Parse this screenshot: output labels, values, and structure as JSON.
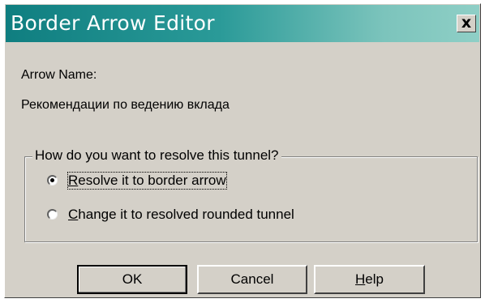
{
  "window": {
    "title": "Border Arrow Editor",
    "close_glyph": "x"
  },
  "arrow": {
    "name_label": "Arrow Name:",
    "name_value": "Рекомендации по ведению вклада"
  },
  "group": {
    "legend": "How do you want to resolve this tunnel?",
    "options": [
      {
        "mnemonic": "R",
        "rest": "esolve it to border arrow",
        "selected": true
      },
      {
        "mnemonic": "C",
        "rest": "hange it to resolved rounded tunnel",
        "selected": false
      }
    ]
  },
  "buttons": {
    "ok": "OK",
    "cancel": "Cancel",
    "help_mnemonic": "H",
    "help_rest": "elp"
  }
}
